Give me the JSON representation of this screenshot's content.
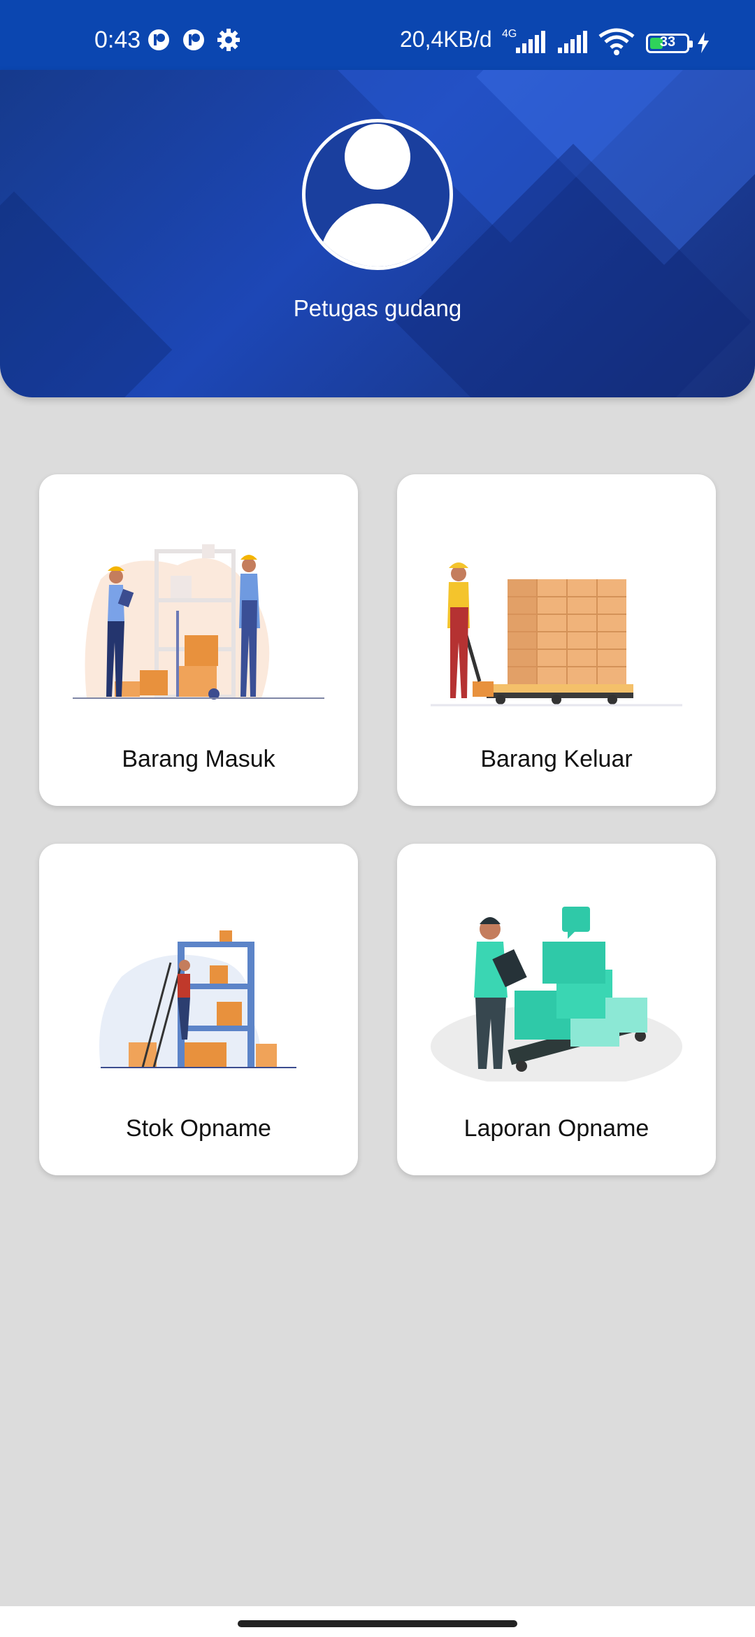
{
  "status_bar": {
    "time": "0:43",
    "net_speed": "20,4KB/d",
    "network_type": "4G",
    "battery_level": "33",
    "battery_fraction": 0.33,
    "icons": [
      "app-notification-icon",
      "app-notification-icon",
      "gear-icon",
      "signal-icon",
      "signal-icon",
      "wifi-icon",
      "battery-icon",
      "charging-icon"
    ]
  },
  "header": {
    "user_name": "Petugas gudang",
    "avatar_icon": "person-icon"
  },
  "menu": {
    "items": [
      {
        "label": "Barang Masuk",
        "illustration": "warehouse-incoming-illustration"
      },
      {
        "label": "Barang Keluar",
        "illustration": "pallet-jack-illustration"
      },
      {
        "label": "Stok Opname",
        "illustration": "ladder-shelf-illustration"
      },
      {
        "label": "Laporan Opname",
        "illustration": "inventory-report-illustration"
      }
    ]
  },
  "colors": {
    "status_bar": "#0b46b0",
    "header": "#1d47b6",
    "background": "#dcdcdc",
    "card": "#ffffff",
    "accent_orange": "#e8913d",
    "accent_teal": "#2fc9a8"
  }
}
